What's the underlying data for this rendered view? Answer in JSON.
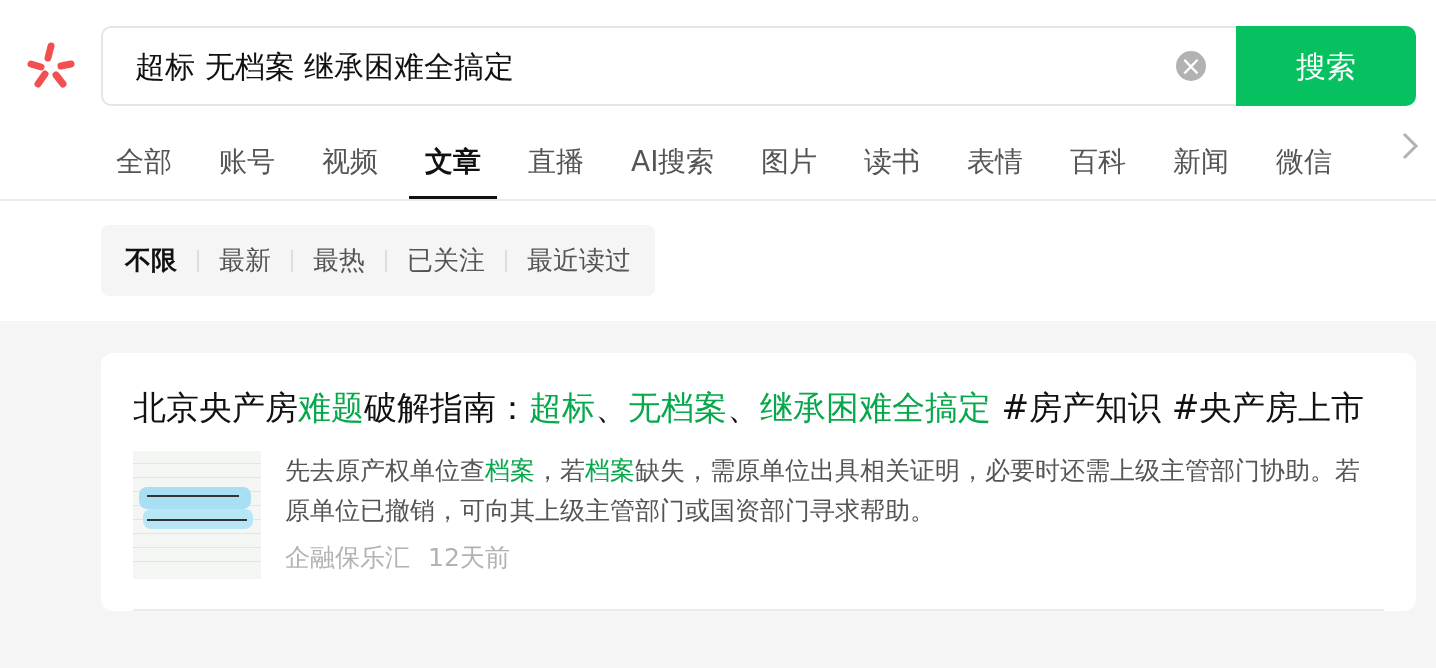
{
  "search": {
    "value": "超标 无档案 继承困难全搞定",
    "clear": "×",
    "button": "搜索"
  },
  "tabs": [
    {
      "label": "全部",
      "selected": false
    },
    {
      "label": "账号",
      "selected": false
    },
    {
      "label": "视频",
      "selected": false
    },
    {
      "label": "文章",
      "selected": true
    },
    {
      "label": "直播",
      "selected": false
    },
    {
      "label": "AI搜索",
      "selected": false
    },
    {
      "label": "图片",
      "selected": false
    },
    {
      "label": "读书",
      "selected": false
    },
    {
      "label": "表情",
      "selected": false
    },
    {
      "label": "百科",
      "selected": false
    },
    {
      "label": "新闻",
      "selected": false
    },
    {
      "label": "微信",
      "selected": false
    }
  ],
  "filters": [
    {
      "label": "不限",
      "selected": true
    },
    {
      "label": "最新",
      "selected": false
    },
    {
      "label": "最热",
      "selected": false
    },
    {
      "label": "已关注",
      "selected": false
    },
    {
      "label": "最近读过",
      "selected": false
    }
  ],
  "results": [
    {
      "title": [
        {
          "text": "北京央产房",
          "highlight": false
        },
        {
          "text": "难题",
          "highlight": true
        },
        {
          "text": "破解指南：",
          "highlight": false
        },
        {
          "text": "超标",
          "highlight": true
        },
        {
          "text": "、",
          "highlight": false
        },
        {
          "text": "无档案",
          "highlight": true
        },
        {
          "text": "、",
          "highlight": false
        },
        {
          "text": "继承困难全搞定",
          "highlight": true
        },
        {
          "text": " #房产知识 #央产房上市",
          "highlight": false
        }
      ],
      "summary": [
        {
          "text": "先去原产权单位查",
          "highlight": false
        },
        {
          "text": "档案",
          "highlight": true
        },
        {
          "text": "，若",
          "highlight": false
        },
        {
          "text": "档案",
          "highlight": true
        },
        {
          "text": "缺失，需原单位出具相关证明，必要时还需上级主管部门协助。若原单位已撤销，可向其上级主管部门或国资部门寻求帮助。",
          "highlight": false
        }
      ],
      "source": "企融保乐汇",
      "time": "12天前"
    }
  ]
}
